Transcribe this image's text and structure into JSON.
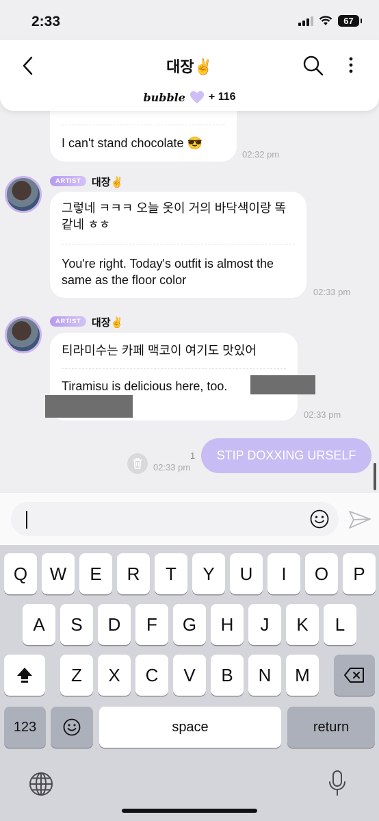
{
  "status_bar": {
    "time": "2:33",
    "battery": "67"
  },
  "header": {
    "title": "대장✌️",
    "brand": "bubble",
    "member_count": "+ 116"
  },
  "messages": [
    {
      "sender": "",
      "text_ko": "",
      "text_en": "I can't stand chocolate 😎",
      "time": "02:32 pm"
    },
    {
      "badge": "ARTIST",
      "sender": "대장✌️",
      "text_ko": "그렇네 ㅋㅋㅋ 오늘 옷이 거의 바닥색이랑 똑같네 ㅎㅎ",
      "text_en": "You're right. Today's outfit is almost the same as the floor color",
      "time": "02:33 pm"
    },
    {
      "badge": "ARTIST",
      "sender": "대장✌️",
      "text_ko": "티라미수는 카페 맥코이 여기도 맛있어",
      "text_en": "Tiramisu is delicious here, too.",
      "time": "02:33 pm"
    }
  ],
  "sent_message": {
    "text": "STIP DOXXING URSELF",
    "read_count": "1",
    "time": "02:33 pm"
  },
  "composer": {
    "value": ""
  },
  "keyboard": {
    "row1": [
      "Q",
      "W",
      "E",
      "R",
      "T",
      "Y",
      "U",
      "I",
      "O",
      "P"
    ],
    "row2": [
      "A",
      "S",
      "D",
      "F",
      "G",
      "H",
      "J",
      "K",
      "L"
    ],
    "row3": [
      "Z",
      "X",
      "C",
      "V",
      "B",
      "N",
      "M"
    ],
    "numbers_key": "123",
    "space_key": "space",
    "return_key": "return"
  },
  "colors": {
    "accent": "#c8bcf4",
    "badge": "#b69af0",
    "background": "#efeef0"
  },
  "icons": [
    "back-chevron-icon",
    "search-icon",
    "more-vertical-icon",
    "heart-icon",
    "trash-icon",
    "emoji-icon",
    "send-icon",
    "shift-icon",
    "backspace-icon",
    "globe-icon",
    "microphone-icon",
    "signal-icon",
    "wifi-icon",
    "battery-icon"
  ]
}
